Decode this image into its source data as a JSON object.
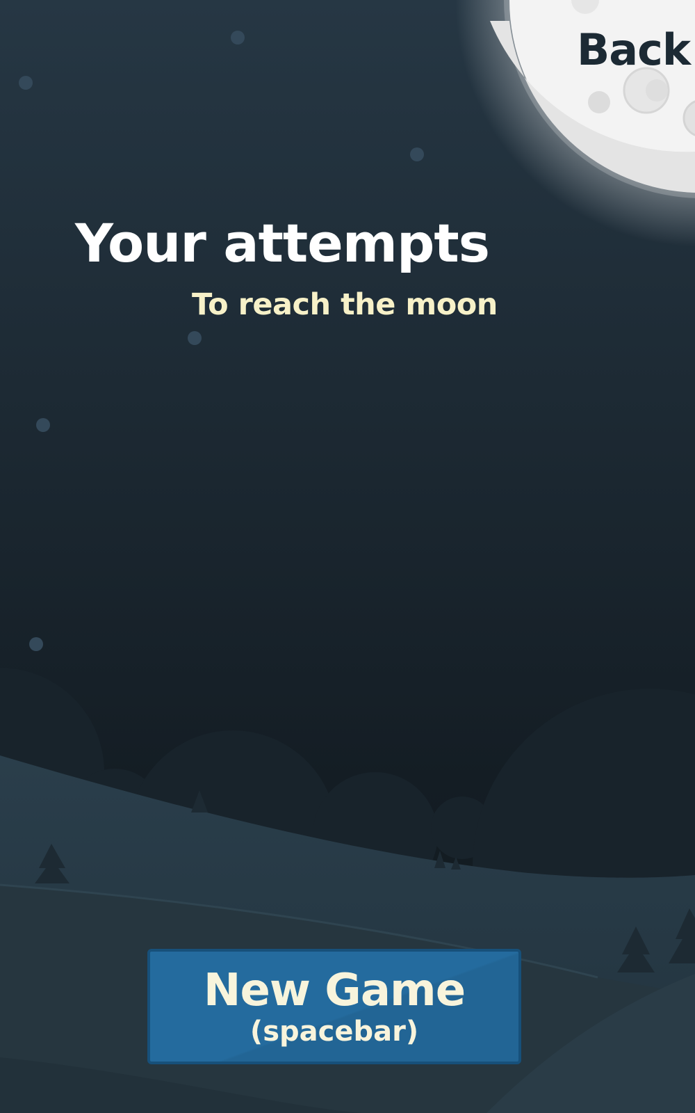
{
  "header": {
    "back_label": "Back"
  },
  "main": {
    "title": "Your attempts",
    "subtitle": "To reach the moon"
  },
  "actions": {
    "new_game_label": "New Game",
    "new_game_hint": "(spacebar)"
  },
  "colors": {
    "sky_top": "#263744",
    "sky_bottom": "#121a20",
    "moon": "#f4f4f4",
    "subtitle": "#f7f1c8",
    "button": "#246b9e",
    "button_border": "#17507a",
    "back_text": "#1c2a34"
  }
}
